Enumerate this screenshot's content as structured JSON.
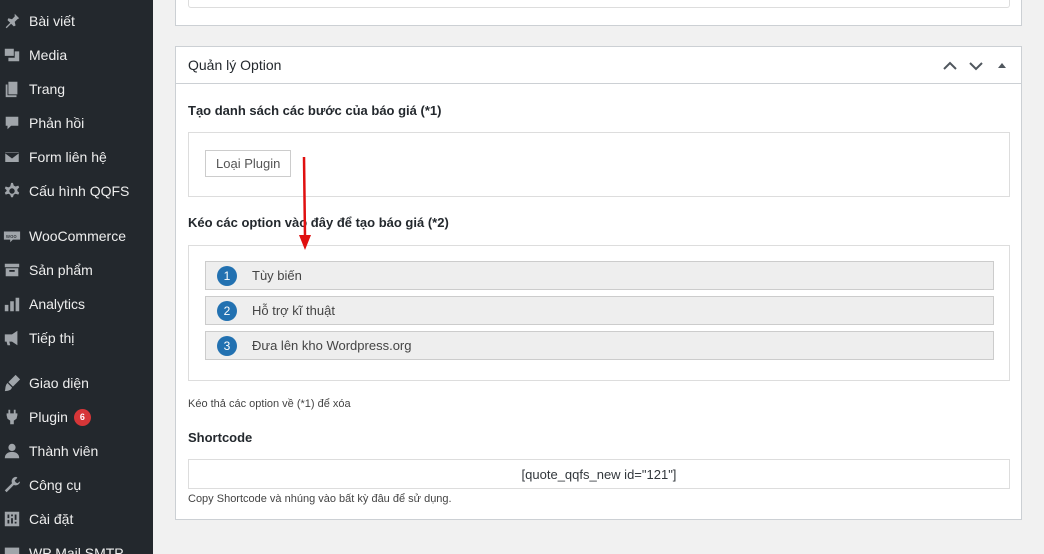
{
  "sidebar": {
    "items": [
      {
        "label": "Bài viết",
        "icon": "pin-icon"
      },
      {
        "label": "Media",
        "icon": "media-icon"
      },
      {
        "label": "Trang",
        "icon": "page-icon"
      },
      {
        "label": "Phản hồi",
        "icon": "comment-icon"
      },
      {
        "label": "Form liên hệ",
        "icon": "mail-icon"
      },
      {
        "label": "Cấu hình QQFS",
        "icon": "gear-icon"
      },
      {
        "label": "WooCommerce",
        "icon": "woo-icon"
      },
      {
        "label": "Sản phẩm",
        "icon": "archive-icon"
      },
      {
        "label": "Analytics",
        "icon": "chart-bar-icon"
      },
      {
        "label": "Tiếp thị",
        "icon": "megaphone-icon"
      },
      {
        "label": "Giao diện",
        "icon": "brush-icon"
      },
      {
        "label": "Plugin",
        "icon": "plug-icon",
        "badge": "6"
      },
      {
        "label": "Thành viên",
        "icon": "user-icon"
      },
      {
        "label": "Công cụ",
        "icon": "wrench-icon"
      },
      {
        "label": "Cài đặt",
        "icon": "settings-icon"
      },
      {
        "label": "WP Mail SMTP",
        "icon": "mail-smtp-icon"
      }
    ]
  },
  "postbox": {
    "title": "Quản lý Option",
    "steps_label": "Tạo danh sách các bước của báo giá (*1)",
    "plugin_button": "Loại Plugin",
    "drag_label": "Kéo các option vào đây để tạo báo giá (*2)",
    "options": [
      {
        "num": "1",
        "label": "Tùy biến"
      },
      {
        "num": "2",
        "label": "Hỗ trợ kĩ thuật"
      },
      {
        "num": "3",
        "label": "Đưa lên kho Wordpress.org"
      }
    ],
    "drag_hint": "Kéo thả các option về (*1) để xóa",
    "shortcode_label": "Shortcode",
    "shortcode_value": "[quote_qqfs_new id=\"121\"]",
    "shortcode_hint": "Copy Shortcode và nhúng vào bất kỳ đâu để sử dụng."
  },
  "colors": {
    "sidebar_bg": "#23282d",
    "accent": "#2271b1",
    "badge": "#d63638",
    "arrow": "#e01010"
  }
}
